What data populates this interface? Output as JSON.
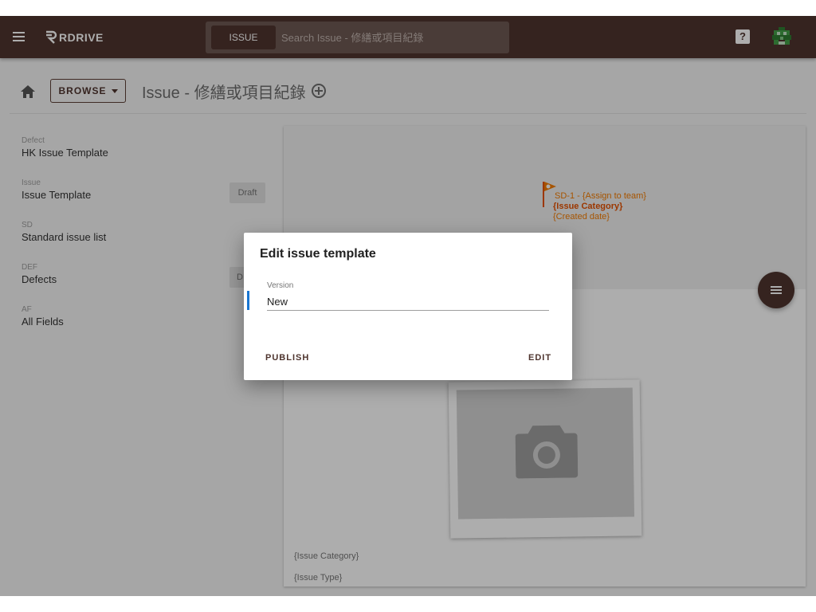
{
  "topbar": {
    "app_name": "RDRIVE",
    "search_chip": "ISSUE",
    "search_placeholder": "Search Issue - 修繕或項目紀錄",
    "help_label": "?",
    "brand_color": "#4e342e"
  },
  "subheader": {
    "browse_label": "BROWSE",
    "page_title": "Issue - 修繕或項目紀錄"
  },
  "templates": [
    {
      "code": "Defect",
      "name": "HK Issue Template",
      "status": ""
    },
    {
      "code": "Issue",
      "name": "Issue Template",
      "status": "Draft"
    },
    {
      "code": "SD",
      "name": "Standard issue list",
      "status": ""
    },
    {
      "code": "DEF",
      "name": "Defects",
      "status": "D"
    },
    {
      "code": "AF",
      "name": "All Fields",
      "status": ""
    }
  ],
  "preview": {
    "line1": "SD-1 - {Assign to team}",
    "line2": "{Issue Category}",
    "line3": "{Created date}",
    "category": "{Issue Category}",
    "type": "{Issue Type}"
  },
  "dialog": {
    "title": "Edit issue template",
    "field_label": "Version",
    "field_value": "New",
    "publish_label": "PUBLISH",
    "edit_label": "EDIT",
    "accent_color": "#1976d2"
  }
}
